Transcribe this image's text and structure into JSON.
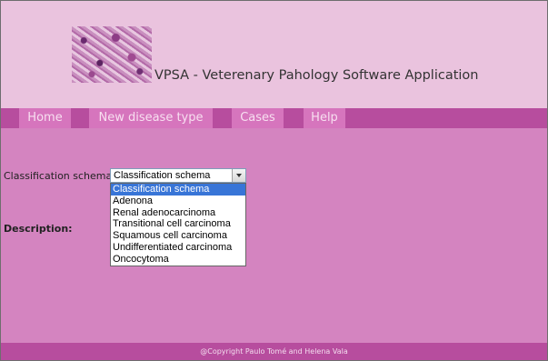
{
  "header": {
    "title": "VPSA - Veterenary Pahology Software Application",
    "logo_icon": "pathology-slide-image"
  },
  "nav": {
    "items": [
      {
        "label": "Home"
      },
      {
        "label": "New disease type"
      },
      {
        "label": "Cases"
      },
      {
        "label": "Help"
      }
    ]
  },
  "form": {
    "classification_label": "Classification schema:",
    "classification_selected": "Classification schema",
    "options": [
      "Classification schema",
      "Adenona",
      "Renal adenocarcinoma",
      "Transitional cell carcinoma",
      "Squamous cell carcinoma",
      "Undifferentiated carcinoma",
      "Oncocytoma"
    ],
    "description_label": "Description:"
  },
  "footer": {
    "copyright": "@Copyright Paulo Tomé and Helena Vala"
  },
  "colors": {
    "header_bg": "#eac3de",
    "nav_bg": "#b74d9e",
    "nav_item_bg": "#d675bd",
    "content_bg": "#d484c0",
    "highlight": "#3875d7"
  }
}
